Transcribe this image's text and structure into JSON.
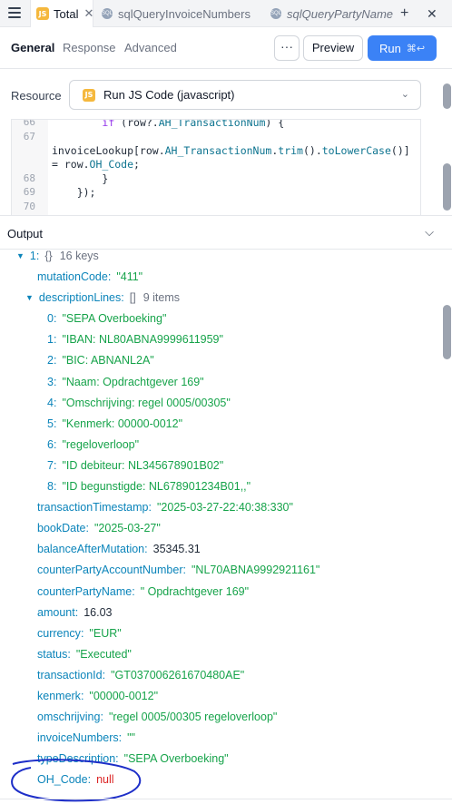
{
  "tabs": [
    {
      "label": "Total",
      "icon": "js-file-icon",
      "active": true,
      "closable": true
    },
    {
      "label": "sqlQueryInvoiceNumbers",
      "icon": "sql-query-icon",
      "active": false
    },
    {
      "label": "sqlQueryPartyNames",
      "icon": "sql-query-icon",
      "active": false
    }
  ],
  "subtabs": {
    "general": "General",
    "response": "Response",
    "advanced": "Advanced"
  },
  "toolbar": {
    "more": "···",
    "preview": "Preview",
    "run": "Run",
    "run_shortcut": "⌘↩"
  },
  "resource": {
    "label": "Resource",
    "value": "Run JS Code (javascript)",
    "badge": "JS"
  },
  "editor": {
    "lines": [
      {
        "num": "66",
        "code": "        if (row?.AH_TransactionNum) {"
      },
      {
        "num": "67",
        "code": ""
      },
      {
        "num": "",
        "code": "invoiceLookup[row.AH_TransactionNum.trim().toLowerCase()]"
      },
      {
        "num": "",
        "code": "= row.OH_Code;"
      },
      {
        "num": "68",
        "code": "        }"
      },
      {
        "num": "69",
        "code": "    });"
      },
      {
        "num": "70",
        "code": ""
      }
    ]
  },
  "output": {
    "title": "Output",
    "root": {
      "key": "1",
      "type": "{}",
      "count": "16 keys"
    },
    "rows": [
      {
        "key": "mutationCode",
        "value": "\"411\"",
        "kind": "str"
      },
      {
        "key": "descriptionLines",
        "type": "[]",
        "count": "9 items",
        "kind": "array"
      },
      {
        "key": "0",
        "value": "\"SEPA Overboeking\"",
        "kind": "str",
        "indent": 2
      },
      {
        "key": "1",
        "value": "\"IBAN: NL80ABNA9999611959\"",
        "kind": "str",
        "indent": 2
      },
      {
        "key": "2",
        "value": "\"BIC: ABNANL2A\"",
        "kind": "str",
        "indent": 2
      },
      {
        "key": "3",
        "value": "\"Naam: Opdrachtgever 169\"",
        "kind": "str",
        "indent": 2
      },
      {
        "key": "4",
        "value": "\"Omschrijving: regel 0005/00305\"",
        "kind": "str",
        "indent": 2
      },
      {
        "key": "5",
        "value": "\"Kenmerk: 00000-0012\"",
        "kind": "str",
        "indent": 2
      },
      {
        "key": "6",
        "value": "\"regeloverloop\"",
        "kind": "str",
        "indent": 2
      },
      {
        "key": "7",
        "value": "\"ID debiteur: NL345678901B02\"",
        "kind": "str",
        "indent": 2
      },
      {
        "key": "8",
        "value": "\"ID begunstigde: NL678901234B01,,\"",
        "kind": "str",
        "indent": 2
      },
      {
        "key": "transactionTimestamp",
        "value": "\"2025-03-27-22:40:38:330\"",
        "kind": "str"
      },
      {
        "key": "bookDate",
        "value": "\"2025-03-27\"",
        "kind": "str"
      },
      {
        "key": "balanceAfterMutation",
        "value": "35345.31",
        "kind": "num"
      },
      {
        "key": "counterPartyAccountNumber",
        "value": "\"NL70ABNA9992921161\"",
        "kind": "str"
      },
      {
        "key": "counterPartyName",
        "value": "\" Opdrachtgever 169\"",
        "kind": "str"
      },
      {
        "key": "amount",
        "value": "16.03",
        "kind": "num"
      },
      {
        "key": "currency",
        "value": "\"EUR\"",
        "kind": "str"
      },
      {
        "key": "status",
        "value": "\"Executed\"",
        "kind": "str"
      },
      {
        "key": "transactionId",
        "value": "\"GT037006261670480AE\"",
        "kind": "str"
      },
      {
        "key": "kenmerk",
        "value": "\"00000-0012\"",
        "kind": "str"
      },
      {
        "key": "omschrijving",
        "value": "\"regel 0005/00305 regeloverloop\"",
        "kind": "str"
      },
      {
        "key": "invoiceNumbers",
        "value": "\"\"",
        "kind": "str"
      },
      {
        "key": "typeDescription",
        "value": "\"SEPA Overboeking\"",
        "kind": "str"
      },
      {
        "key": "OH_Code",
        "value": "null",
        "kind": "null"
      }
    ]
  },
  "colors": {
    "accent": "#3b82f6",
    "key": "#0b84ba",
    "string": "#16a34a",
    "null": "#dc2626",
    "annotation": "#1d2ec8"
  }
}
